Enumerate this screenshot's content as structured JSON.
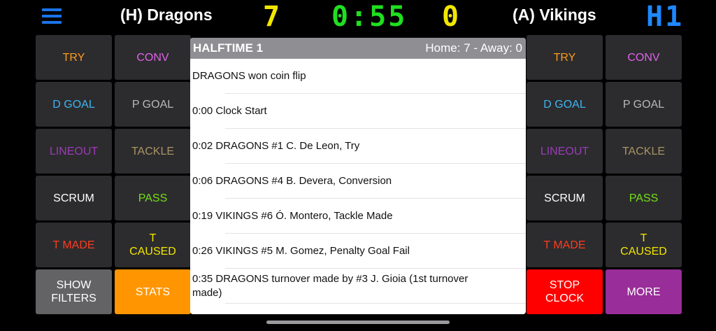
{
  "header": {
    "home_team": "(H) Dragons",
    "away_team": "(A) Vikings",
    "home_score": "7",
    "away_score": "0",
    "clock": "0:55",
    "half": "H1"
  },
  "left_buttons": [
    {
      "label": "TRY",
      "color": "#ff9a1a",
      "bg": "#2c2c2e"
    },
    {
      "label": "CONV",
      "color": "#e062e8",
      "bg": "#2c2c2e"
    },
    {
      "label": "D GOAL",
      "color": "#3fb4f0",
      "bg": "#2c2c2e"
    },
    {
      "label": "P GOAL",
      "color": "#b8b8b8",
      "bg": "#2c2c2e"
    },
    {
      "label": "LINEOUT",
      "color": "#9b3bb8",
      "bg": "#2c2c2e"
    },
    {
      "label": "TACKLE",
      "color": "#a99563",
      "bg": "#2c2c2e"
    },
    {
      "label": "SCRUM",
      "color": "#ffffff",
      "bg": "#2c2c2e"
    },
    {
      "label": "PASS",
      "color": "#74e017",
      "bg": "#2c2c2e"
    },
    {
      "label": "T MADE",
      "color": "#ff3b1f",
      "bg": "#2c2c2e"
    },
    {
      "label": "T CAUSED",
      "color": "#f2e600",
      "bg": "#2c2c2e"
    },
    {
      "label": "SHOW FILTERS",
      "color": "#ffffff",
      "bg": "#636366"
    },
    {
      "label": "STATS",
      "color": "#ffffff",
      "bg": "#ff9500"
    }
  ],
  "right_buttons": [
    {
      "label": "TRY",
      "color": "#ff9a1a",
      "bg": "#2c2c2e"
    },
    {
      "label": "CONV",
      "color": "#e062e8",
      "bg": "#2c2c2e"
    },
    {
      "label": "D GOAL",
      "color": "#3fb4f0",
      "bg": "#2c2c2e"
    },
    {
      "label": "P GOAL",
      "color": "#b8b8b8",
      "bg": "#2c2c2e"
    },
    {
      "label": "LINEOUT",
      "color": "#9b3bb8",
      "bg": "#2c2c2e"
    },
    {
      "label": "TACKLE",
      "color": "#a99563",
      "bg": "#2c2c2e"
    },
    {
      "label": "SCRUM",
      "color": "#ffffff",
      "bg": "#2c2c2e"
    },
    {
      "label": "PASS",
      "color": "#74e017",
      "bg": "#2c2c2e"
    },
    {
      "label": "T MADE",
      "color": "#ff3b1f",
      "bg": "#2c2c2e"
    },
    {
      "label": "T CAUSED",
      "color": "#f2e600",
      "bg": "#2c2c2e"
    },
    {
      "label": "STOP CLOCK",
      "color": "#ffffff",
      "bg": "#ff0000"
    },
    {
      "label": "MORE",
      "color": "#ffffff",
      "bg": "#992d99"
    }
  ],
  "log": {
    "title": "HALFTIME 1",
    "score_summary": "Home: 7 - Away: 0",
    "entries": [
      "DRAGONS won coin flip",
      "0:00 Clock Start",
      "0:02 DRAGONS #1 C. De Leon, Try",
      "0:06 DRAGONS #4 B. Devera, Conversion",
      "0:19 VIKINGS #6 Ó. Montero, Tackle Made",
      "0:26 VIKINGS #5 M. Gomez, Penalty Goal Fail",
      "0:35 DRAGONS turnover made by #3 J. Gioia (1st turnover made)"
    ]
  },
  "icons": {
    "menu": "hamburger-menu-icon"
  },
  "colors": {
    "menu_blue": "#1a74e8",
    "score_yellow": "#f2e600",
    "clock_green": "#1fe01f",
    "half_blue": "#1e88ff"
  }
}
